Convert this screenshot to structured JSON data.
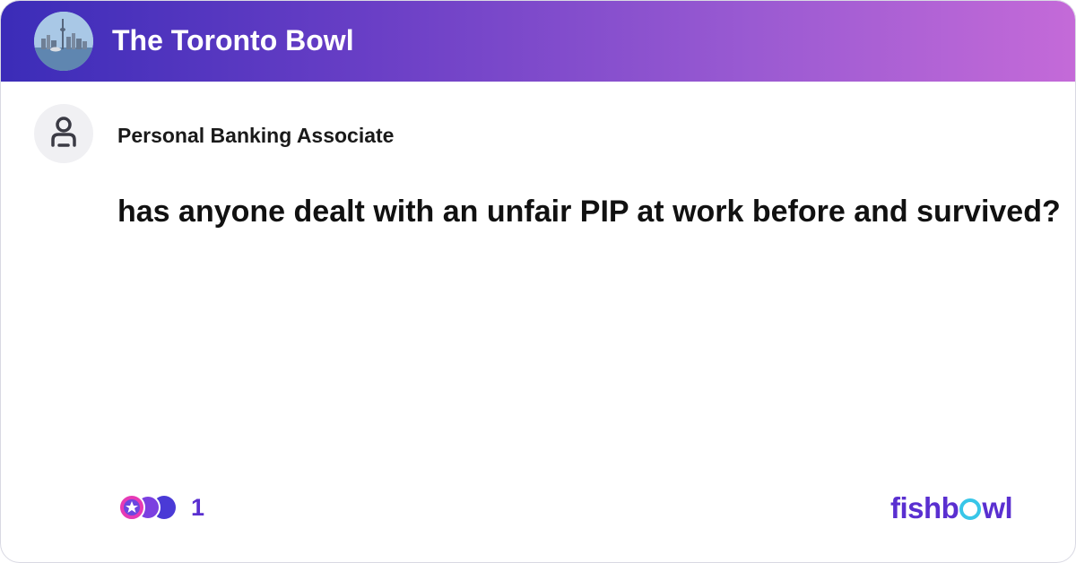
{
  "header": {
    "title": "The Toronto Bowl",
    "avatar_icon": "toronto-skyline-icon"
  },
  "post": {
    "author_title": "Personal Banking Associate",
    "author_icon": "user-icon",
    "text": "has anyone dealt with an unfair PIP at work before and survived?"
  },
  "footer": {
    "reaction_icon": "reaction-stack-icon",
    "reaction_count": "1",
    "logo": {
      "part1": "fishb",
      "part2": "wl"
    }
  },
  "colors": {
    "header_gradient_start": "#3b2cb8",
    "header_gradient_end": "#c46ad8",
    "accent": "#5a2fd0",
    "logo_o": "#38c6e8"
  }
}
